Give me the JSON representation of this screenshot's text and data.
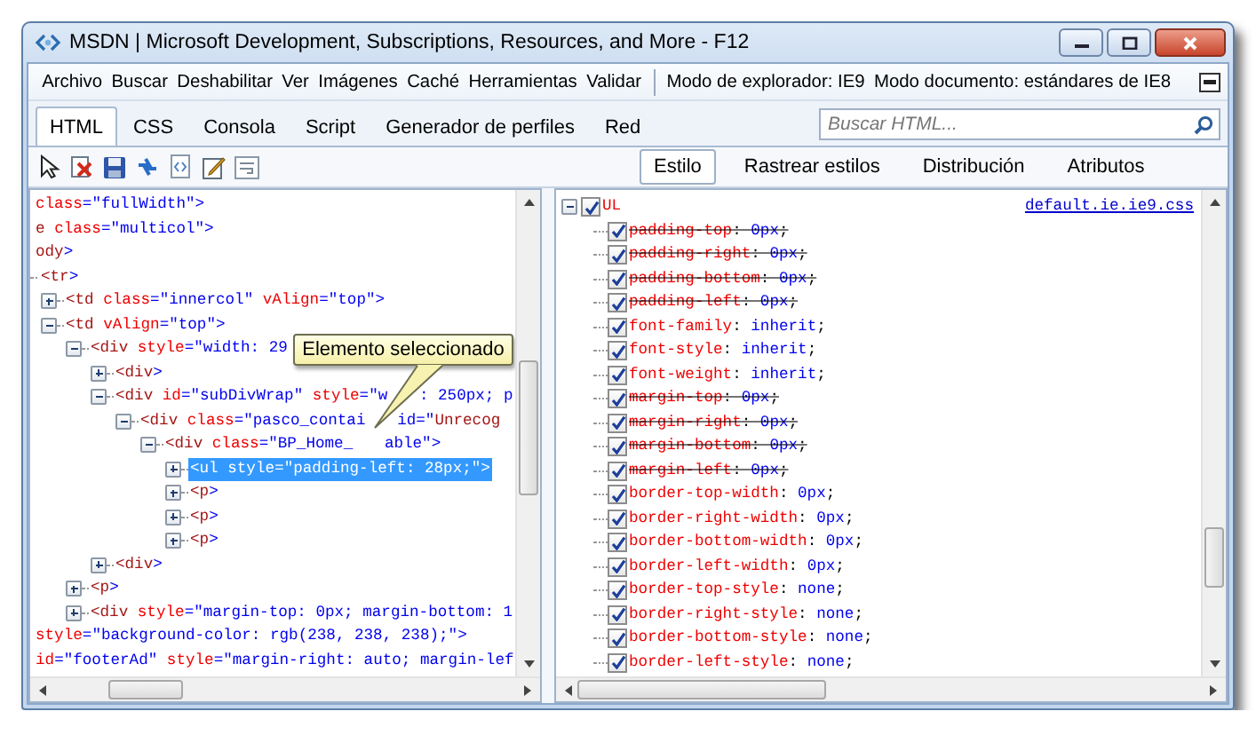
{
  "window": {
    "title": "MSDN | Microsoft Development, Subscriptions, Resources, and More - F12"
  },
  "menu": [
    "Archivo",
    "Buscar",
    "Deshabilitar",
    "Ver",
    "Imágenes",
    "Caché",
    "Herramientas",
    "Validar"
  ],
  "modes": [
    "Modo de explorador: IE9",
    "Modo documento: estándares de IE8"
  ],
  "tabs": [
    {
      "label": "HTML",
      "selected": true
    },
    {
      "label": "CSS",
      "selected": false
    },
    {
      "label": "Consola",
      "selected": false
    },
    {
      "label": "Script",
      "selected": false
    },
    {
      "label": "Generador de perfiles",
      "selected": false
    },
    {
      "label": "Red",
      "selected": false
    }
  ],
  "search": {
    "placeholder": "Buscar HTML..."
  },
  "style_tabs": [
    {
      "label": "Estilo",
      "selected": true
    },
    {
      "label": "Rastrear estilos",
      "selected": false
    },
    {
      "label": "Distribución",
      "selected": false
    },
    {
      "label": "Atributos",
      "selected": false
    }
  ],
  "html_tree": [
    {
      "text": "class=\"fullWidth\">",
      "selected": false
    },
    {
      "text": "e class=\"multicol\">",
      "selected": false
    },
    {
      "text": "ody>",
      "selected": false
    },
    {
      "text": "<tr>",
      "selected": false,
      "children": [
        {
          "text": "<td class=\"innercol\" vAlign=\"top\">",
          "expanded": false,
          "selected": false
        },
        {
          "text": "<td vAlign=\"top\">",
          "expanded": true,
          "selected": false,
          "children": [
            {
              "text": "<div style=\"width: 29",
              "expanded": true,
              "selected": false,
              "children": [
                {
                  "text": "<div>",
                  "expanded": false,
                  "selected": false
                },
                {
                  "text": "<div id=\"subDivWrap\" style=\"w",
                  "text_after": ": 250px; p",
                  "expanded": true,
                  "selected": false,
                  "children": [
                    {
                      "text": "<div class=\"pasco_contai",
                      "text_after": "id=\"Unrecog",
                      "expanded": true,
                      "selected": false,
                      "children": [
                        {
                          "text": "<div class=\"BP_Home_",
                          "text_after": "able\">",
                          "expanded": true,
                          "selected": false,
                          "children": [
                            {
                              "text": "<ul style=\"padding-left: 28px;\">",
                              "expanded": false,
                              "selected": true
                            },
                            {
                              "text": "<p>",
                              "expanded": false,
                              "selected": false
                            },
                            {
                              "text": "<p>",
                              "expanded": false,
                              "selected": false
                            },
                            {
                              "text": "<p>",
                              "expanded": false,
                              "selected": false
                            }
                          ]
                        }
                      ]
                    }
                  ]
                },
                {
                  "text": "<div>",
                  "expanded": false,
                  "selected": false
                }
              ]
            },
            {
              "text": "<p>",
              "expanded": false,
              "selected": false
            },
            {
              "text": "<div style=\"margin-top: 0px; margin-bottom: 1",
              "expanded": false,
              "selected": false
            }
          ]
        }
      ]
    },
    {
      "text": "style=\"background-color: rgb(238, 238, 238);\">",
      "selected": false
    },
    {
      "text": "id=\"footerAd\" style=\"margin-right: auto; margin-lef",
      "selected": false
    }
  ],
  "tooltip": {
    "text": "Elemento seleccionado"
  },
  "style_rule": {
    "selector": "UL",
    "checked": true,
    "expanded": true,
    "source": "default.ie.ie9.css",
    "properties": [
      {
        "text": "padding-top: 0px;",
        "checked": true,
        "overridden": true
      },
      {
        "text": "padding-right: 0px;",
        "checked": true,
        "overridden": true
      },
      {
        "text": "padding-bottom: 0px;",
        "checked": true,
        "overridden": true
      },
      {
        "text": "padding-left: 0px;",
        "checked": true,
        "overridden": true
      },
      {
        "text": "font-family: inherit;",
        "checked": true,
        "overridden": false
      },
      {
        "text": "font-style: inherit;",
        "checked": true,
        "overridden": false
      },
      {
        "text": "font-weight: inherit;",
        "checked": true,
        "overridden": false
      },
      {
        "text": "margin-top: 0px;",
        "checked": true,
        "overridden": true
      },
      {
        "text": "margin-right: 0px;",
        "checked": true,
        "overridden": true
      },
      {
        "text": "margin-bottom: 0px;",
        "checked": true,
        "overridden": true
      },
      {
        "text": "margin-left: 0px;",
        "checked": true,
        "overridden": true
      },
      {
        "text": "border-top-width: 0px;",
        "checked": true,
        "overridden": false
      },
      {
        "text": "border-right-width: 0px;",
        "checked": true,
        "overridden": false
      },
      {
        "text": "border-bottom-width: 0px;",
        "checked": true,
        "overridden": false
      },
      {
        "text": "border-left-width: 0px;",
        "checked": true,
        "overridden": false
      },
      {
        "text": "border-top-style: none;",
        "checked": true,
        "overridden": false
      },
      {
        "text": "border-right-style: none;",
        "checked": true,
        "overridden": false
      },
      {
        "text": "border-bottom-style: none;",
        "checked": true,
        "overridden": false
      },
      {
        "text": "border-left-style: none;",
        "checked": true,
        "overridden": false
      }
    ]
  }
}
